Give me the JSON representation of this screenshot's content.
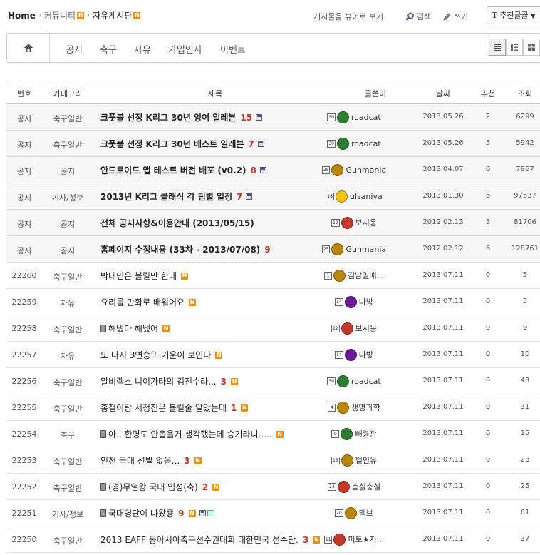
{
  "breadcrumb": {
    "home": "Home",
    "community": "커뮤니티",
    "board": "자유게시판",
    "badge": "N"
  },
  "toplinks": {
    "view_mode": "게시물을 뷰어로 보기",
    "search": "검색",
    "write": "쓰기"
  },
  "sort": {
    "icon": "T",
    "label": "추천글골"
  },
  "nav": {
    "tabs": [
      "공지",
      "축구",
      "자유",
      "가입인사",
      "이벤트"
    ]
  },
  "table": {
    "headers": {
      "num": "번호",
      "category": "카테고리",
      "title": "제목",
      "author": "글쓴이",
      "date": "날짜",
      "recommend": "추천",
      "views": "조회"
    },
    "rows": [
      {
        "num": "공지",
        "category": "축구일반",
        "title": "크풋볼 선정 K리그 30년 잉여 일레븐",
        "comments": "15",
        "level": "30",
        "author": "roadcat",
        "date": "2013.05.26",
        "rec": "2",
        "views": "6299",
        "color": "#2e7d32",
        "notice": true,
        "floppy": true
      },
      {
        "num": "공지",
        "category": "축구일반",
        "title": "크풋볼 선정 K리그 30년 베스트 일레븐",
        "comments": "7",
        "level": "30",
        "author": "roadcat",
        "date": "2013.05.26",
        "rec": "5",
        "views": "5942",
        "color": "#2e7d32",
        "notice": true,
        "floppy": true
      },
      {
        "num": "공지",
        "category": "공지",
        "title": "안드로이드 앱 테스트 버전 배포 (v0.2)",
        "comments": "8",
        "level": "25",
        "author": "Gunmania",
        "date": "2013.04.07",
        "rec": "0",
        "views": "7867",
        "color": "#b8860b",
        "notice": true,
        "floppy": true
      },
      {
        "num": "공지",
        "category": "기사/정보",
        "title": "2013년 K리그 클래식 각 팀별 일정",
        "comments": "7",
        "level": "18",
        "author": "ulsaniya",
        "date": "2013.01.30",
        "rec": "6",
        "views": "97537",
        "color": "#f1c40f",
        "notice": true,
        "floppy": true
      },
      {
        "num": "공지",
        "category": "공지",
        "title": "전체 공지사항&이용안내 (2013/05/15)",
        "comments": "",
        "level": "12",
        "author": "보시옹",
        "date": "2012.02.13",
        "rec": "3",
        "views": "81706",
        "color": "#c0392b",
        "notice": true
      },
      {
        "num": "공지",
        "category": "공지",
        "title": "홈페이지 수정내용 (33차 - 2013/07/08)",
        "comments": "9",
        "level": "25",
        "author": "Gunmania",
        "date": "2012.02.12",
        "rec": "6",
        "views": "128761",
        "color": "#b8860b",
        "notice": true
      },
      {
        "num": "22260",
        "category": "축구일반",
        "title": "박태민은 볼릴만 한데",
        "comments": "",
        "level": "1",
        "author": "김남일매...",
        "date": "2013.07.11",
        "rec": "0",
        "views": "5",
        "color": "#b8860b",
        "new": true
      },
      {
        "num": "22259",
        "category": "자유",
        "title": "요리를 만화로 배워어요",
        "comments": "",
        "level": "14",
        "author": "나방",
        "date": "2013.07.11",
        "rec": "0",
        "views": "5",
        "color": "#6a1b9a",
        "new": true
      },
      {
        "num": "22258",
        "category": "축구일반",
        "title": "해냈다 해냈어",
        "comments": "",
        "level": "12",
        "author": "보시옹",
        "date": "2013.07.11",
        "rec": "0",
        "views": "9",
        "color": "#c0392b",
        "new": true,
        "phone": true
      },
      {
        "num": "22257",
        "category": "자유",
        "title": "또 다시 3연승의 기운이 보인다",
        "comments": "",
        "level": "14",
        "author": "나방",
        "date": "2013.07.11",
        "rec": "0",
        "views": "10",
        "color": "#6a1b9a",
        "new": true
      },
      {
        "num": "22256",
        "category": "축구일반",
        "title": "알비렉스 니이가타의 김진수라...",
        "comments": "3",
        "level": "30",
        "author": "roadcat",
        "date": "2013.07.11",
        "rec": "0",
        "views": "43",
        "color": "#2e7d32",
        "new": true
      },
      {
        "num": "22255",
        "category": "축구일반",
        "title": "홍철이랑 서정진은 볼릴줄 알았는데",
        "comments": "1",
        "level": "4",
        "author": "생명과학",
        "date": "2013.07.11",
        "rec": "0",
        "views": "31",
        "color": "#b8860b",
        "new": true
      },
      {
        "num": "22254",
        "category": "축구",
        "title": "아...한명도 안뽑을거 생각했는데 승기라니.....",
        "comments": "",
        "level": "9",
        "author": "빼령관",
        "date": "2013.07.11",
        "rec": "0",
        "views": "15",
        "color": "#2e7d32",
        "new": true,
        "phone": true
      },
      {
        "num": "22253",
        "category": "축구일반",
        "title": "인천 국대 선발 없음...",
        "comments": "3",
        "level": "16",
        "author": "헬인유",
        "date": "2013.07.11",
        "rec": "0",
        "views": "28",
        "color": "#b8860b",
        "new": true
      },
      {
        "num": "22252",
        "category": "축구일반",
        "title": "(경)무열왕 국대 입성(축)",
        "comments": "2",
        "level": "24",
        "author": "충실충실",
        "date": "2013.07.11",
        "rec": "0",
        "views": "25",
        "color": "#c0392b",
        "new": true,
        "phone": true
      },
      {
        "num": "22251",
        "category": "기사/정보",
        "title": "국대명단이 나왔죵",
        "comments": "9",
        "level": "20",
        "author": "맥브",
        "date": "2013.07.11",
        "rec": "0",
        "views": "61",
        "color": "#b8860b",
        "new": true,
        "phone": true,
        "floppy": true,
        "image": true
      },
      {
        "num": "22250",
        "category": "축구일반",
        "title": "2013 EAFF 동아시아축구선수권대회 대한민국 선수단.",
        "comments": "3",
        "level": "11",
        "author": "미토★지...",
        "date": "2013.07.11",
        "rec": "0",
        "views": "37",
        "color": "#c0392b",
        "new": true
      }
    ]
  }
}
